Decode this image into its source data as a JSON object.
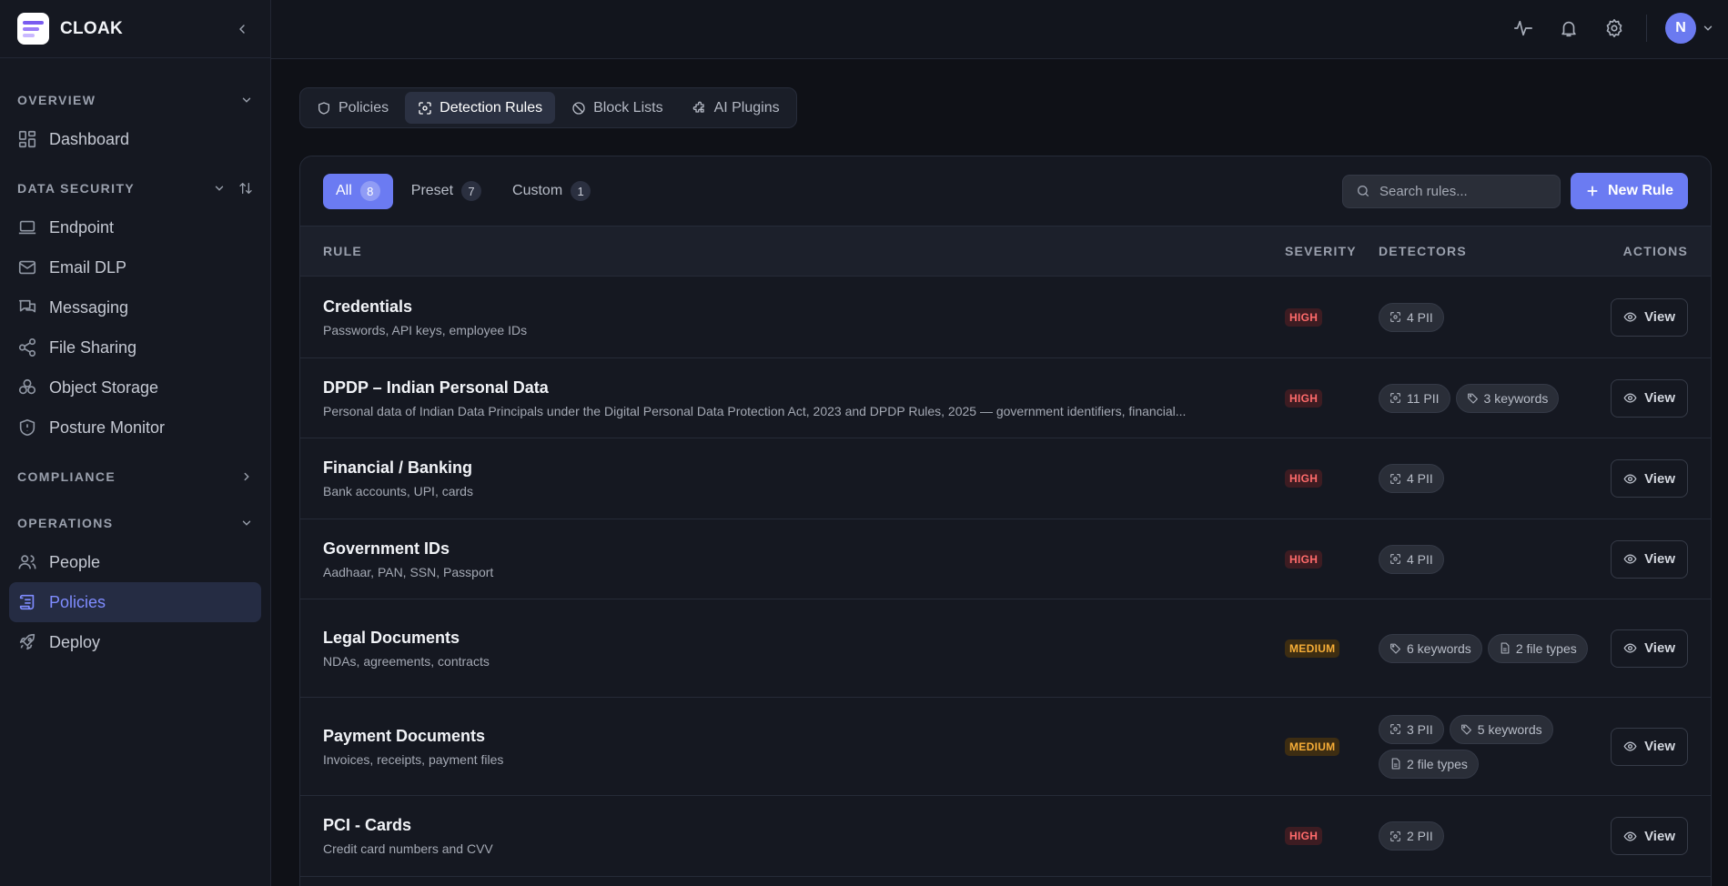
{
  "app": {
    "name": "CLOAK"
  },
  "sidebar": {
    "sections": [
      {
        "title": "OVERVIEW",
        "items": [
          {
            "label": "Dashboard",
            "icon": "dashboard-icon"
          }
        ]
      },
      {
        "title": "DATA SECURITY",
        "items": [
          {
            "label": "Endpoint",
            "icon": "laptop-icon"
          },
          {
            "label": "Email DLP",
            "icon": "mail-icon"
          },
          {
            "label": "Messaging",
            "icon": "chat-icon"
          },
          {
            "label": "File Sharing",
            "icon": "share-icon"
          },
          {
            "label": "Object Storage",
            "icon": "storage-icon"
          },
          {
            "label": "Posture Monitor",
            "icon": "shield-icon"
          }
        ]
      },
      {
        "title": "COMPLIANCE",
        "items": []
      },
      {
        "title": "OPERATIONS",
        "items": [
          {
            "label": "People",
            "icon": "people-icon"
          },
          {
            "label": "Policies",
            "icon": "scroll-icon",
            "active": true
          },
          {
            "label": "Deploy",
            "icon": "rocket-icon"
          }
        ]
      }
    ]
  },
  "topbar": {
    "avatar_initial": "N"
  },
  "tabs": [
    {
      "label": "Policies",
      "icon": "shield-icon"
    },
    {
      "label": "Detection Rules",
      "icon": "scan-icon",
      "active": true
    },
    {
      "label": "Block Lists",
      "icon": "ban-icon"
    },
    {
      "label": "AI Plugins",
      "icon": "puzzle-icon"
    }
  ],
  "filters": [
    {
      "label": "All",
      "count": "8",
      "active": true
    },
    {
      "label": "Preset",
      "count": "7"
    },
    {
      "label": "Custom",
      "count": "1"
    }
  ],
  "search": {
    "placeholder": "Search rules..."
  },
  "new_rule_label": "New Rule",
  "table": {
    "headers": {
      "rule": "RULE",
      "severity": "SEVERITY",
      "detectors": "DETECTORS",
      "actions": "ACTIONS"
    },
    "view_label": "View",
    "rows": [
      {
        "title": "Credentials",
        "desc": "Passwords, API keys, employee IDs",
        "severity": "HIGH",
        "level": "high",
        "detectors": [
          {
            "label": "4 PII",
            "icon": "scan-icon"
          }
        ]
      },
      {
        "title": "DPDP – Indian Personal Data",
        "desc": "Personal data of Indian Data Principals under the Digital Personal Data Protection Act, 2023 and DPDP Rules, 2025 — government identifiers, financial...",
        "severity": "HIGH",
        "level": "high",
        "detectors": [
          {
            "label": "11 PII",
            "icon": "scan-icon"
          },
          {
            "label": "3 keywords",
            "icon": "tag-icon"
          }
        ]
      },
      {
        "title": "Financial / Banking",
        "desc": "Bank accounts, UPI, cards",
        "severity": "HIGH",
        "level": "high",
        "detectors": [
          {
            "label": "4 PII",
            "icon": "scan-icon"
          }
        ]
      },
      {
        "title": "Government IDs",
        "desc": "Aadhaar, PAN, SSN, Passport",
        "severity": "HIGH",
        "level": "high",
        "detectors": [
          {
            "label": "4 PII",
            "icon": "scan-icon"
          }
        ]
      },
      {
        "title": "Legal Documents",
        "desc": "NDAs, agreements, contracts",
        "severity": "MEDIUM",
        "level": "medium",
        "detectors": [
          {
            "label": "6 keywords",
            "icon": "tag-icon"
          },
          {
            "label": "2 file types",
            "icon": "file-icon"
          }
        ]
      },
      {
        "title": "Payment Documents",
        "desc": "Invoices, receipts, payment files",
        "severity": "MEDIUM",
        "level": "medium",
        "detectors": [
          {
            "label": "3 PII",
            "icon": "scan-icon"
          },
          {
            "label": "5 keywords",
            "icon": "tag-icon"
          },
          {
            "label": "2 file types",
            "icon": "file-icon"
          }
        ]
      },
      {
        "title": "PCI - Cards",
        "desc": "Credit card numbers and CVV",
        "severity": "HIGH",
        "level": "high",
        "detectors": [
          {
            "label": "2 PII",
            "icon": "scan-icon"
          }
        ]
      }
    ]
  },
  "colors": {
    "accent": "#6b7bf2",
    "high": "#ff6b6b",
    "medium": "#f6ad37",
    "background": "#0f1117"
  }
}
